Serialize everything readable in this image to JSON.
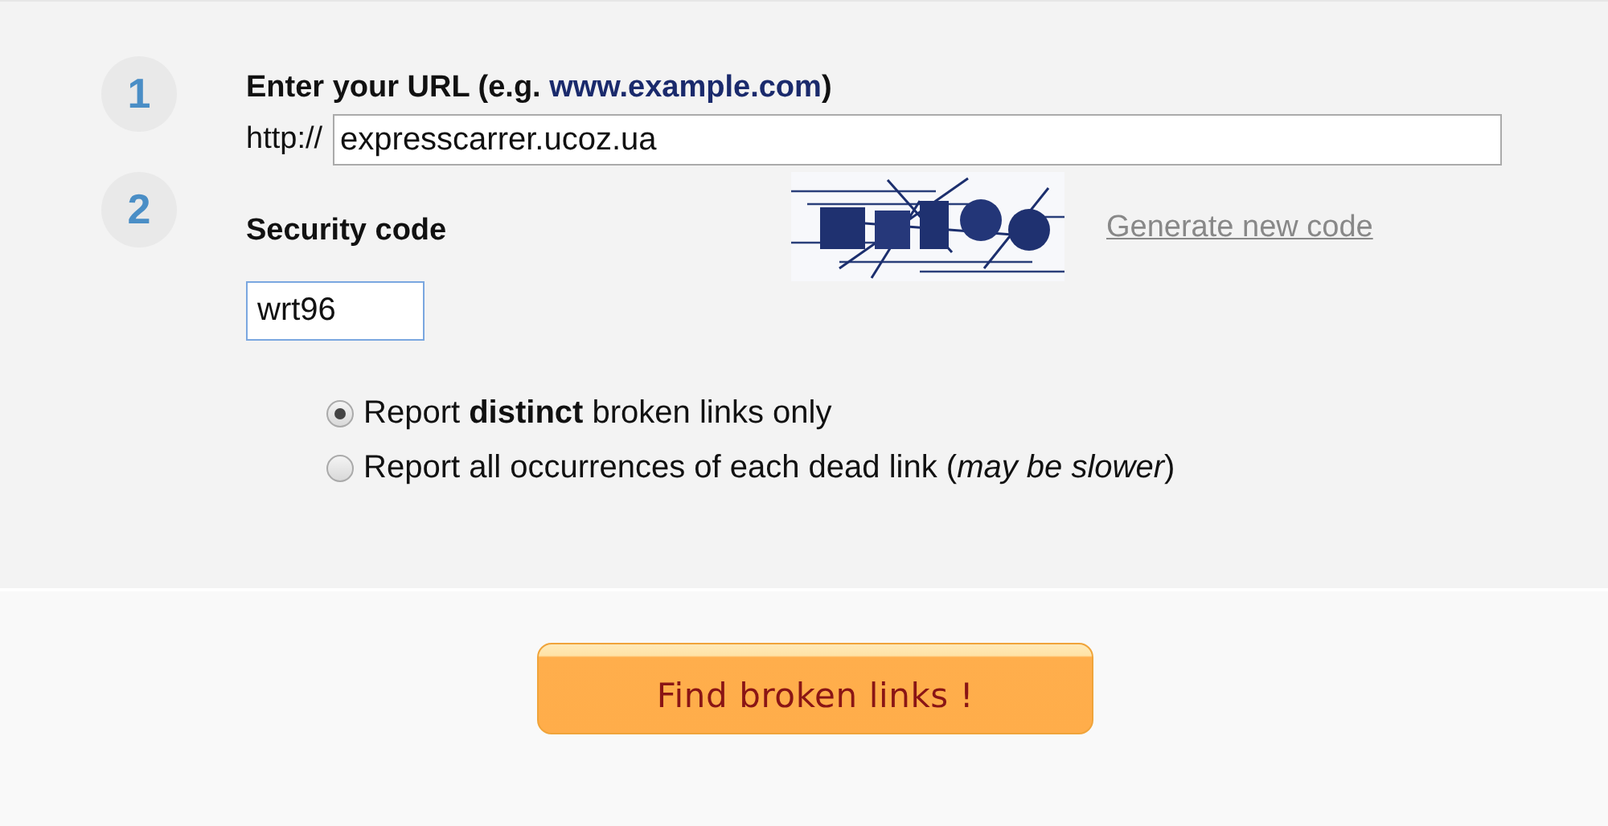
{
  "steps": [
    {
      "number": "1",
      "title_parts": [
        "Enter your URL (e.g. ",
        "www.example.com",
        ")"
      ],
      "prefix": "http://",
      "url_value": "expresscarrer.ucoz.ua"
    },
    {
      "number": "2",
      "title": "Security code",
      "link": "Generate new code",
      "code_value": "wrt96"
    }
  ],
  "options": [
    {
      "label": "Report **distinct** broken links only",
      "selected": true
    },
    {
      "label": "Report all occurrences of each dead link (*may be slower*)",
      "selected": false
    }
  ],
  "button": "Find broken links !"
}
